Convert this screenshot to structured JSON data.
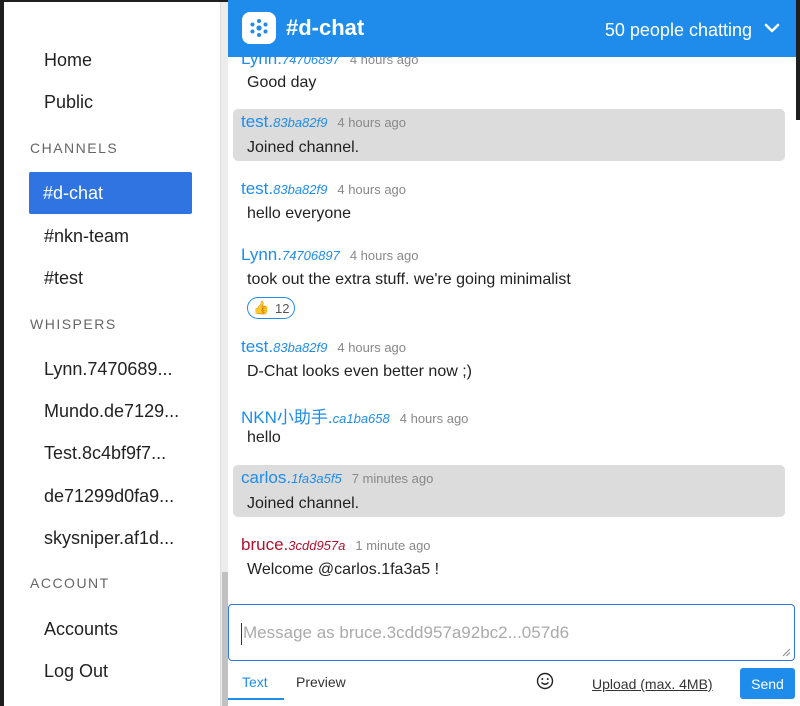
{
  "sidebar": {
    "nav": [
      {
        "label": "Home"
      },
      {
        "label": "Public"
      }
    ],
    "channels_title": "CHANNELS",
    "channels": [
      {
        "label": "#d-chat"
      },
      {
        "label": "#nkn-team"
      },
      {
        "label": "#test"
      }
    ],
    "whispers_title": "WHISPERS",
    "whispers": [
      {
        "label": "Lynn.7470689..."
      },
      {
        "label": "Mundo.de7129..."
      },
      {
        "label": "Test.8c4bf9f7..."
      },
      {
        "label": "de71299d0fa9..."
      },
      {
        "label": "skysniper.af1d..."
      }
    ],
    "account_title": "ACCOUNT",
    "account": [
      {
        "label": "Accounts"
      },
      {
        "label": "Log Out"
      }
    ]
  },
  "header": {
    "title": "#d-chat",
    "people": "50 people chatting",
    "accent": "#1f8ceb"
  },
  "messages": [
    {
      "name": "Lynn.",
      "suffix": "74706897",
      "time": "4 hours ago",
      "body": "Good day"
    },
    {
      "name": "test.",
      "suffix": "83ba82f9",
      "time": "4 hours ago",
      "body": "Joined channel."
    },
    {
      "name": "test.",
      "suffix": "83ba82f9",
      "time": "4 hours ago",
      "body": "hello everyone"
    },
    {
      "name": "Lynn.",
      "suffix": "74706897",
      "time": "4 hours ago",
      "body": "took out the extra stuff. we're going minimalist",
      "reaction_emoji": "👍",
      "reaction_count": "12"
    },
    {
      "name": "test.",
      "suffix": "83ba82f9",
      "time": "4 hours ago",
      "body": "D-Chat looks even better now ;)"
    },
    {
      "name": "NKN小助手.",
      "suffix": "ca1ba658",
      "time": "4 hours ago",
      "body": "hello"
    },
    {
      "name": "carlos.",
      "suffix": "1fa3a5f5",
      "time": "7 minutes ago",
      "body": "Joined channel."
    },
    {
      "name": "bruce.",
      "suffix": "3cdd957a",
      "time": "1 minute ago",
      "body": "Welcome @carlos.1fa3a5 !"
    }
  ],
  "composer": {
    "placeholder": "Message as bruce.3cdd957a92bc2...057d6",
    "tab_text": "Text",
    "tab_preview": "Preview",
    "upload": "Upload (max. 4MB)",
    "send": "Send"
  }
}
